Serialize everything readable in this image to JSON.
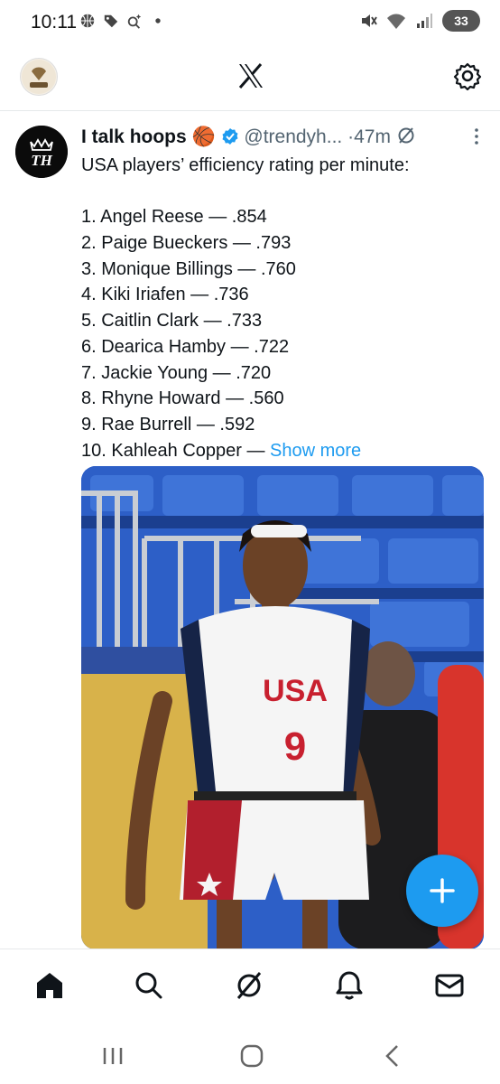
{
  "status_bar": {
    "time": "10:11",
    "battery": "33",
    "icons": [
      "basketball-icon",
      "tag-icon",
      "sparkle-search-icon",
      "dot-icon",
      "mute-icon",
      "wifi-icon",
      "signal-icon"
    ]
  },
  "top_bar": {
    "logo_icon": "x-logo-icon",
    "settings_icon": "gear-icon"
  },
  "tweet": {
    "author_name": "I talk hoops",
    "author_emoji": "🏀",
    "handle": "@trendyh...",
    "separator": "·",
    "time": "47m",
    "avatar_monogram": "TH",
    "intro": "USA players’ efficiency rating per minute:",
    "list": [
      "1. Angel Reese — .854",
      "2. Paige Bueckers — .793",
      "3. Monique Billings — .760",
      "4. Kiki Iriafen — .736",
      "5. Caitlin Clark — .733",
      "6. Dearica Hamby — .722",
      "7. Jackie Young — .720",
      "8. Rhyne Howard — .560",
      "9. Rae Burrell — .592"
    ],
    "last_item": "10. Kahleah Copper — ",
    "show_more": "Show more",
    "media": {
      "jersey_text": "USA",
      "jersey_number": "9"
    }
  },
  "fab": {
    "icon": "plus-icon"
  },
  "bottom_nav": {
    "items": [
      "home-icon",
      "search-icon",
      "grok-icon",
      "notifications-icon",
      "messages-icon"
    ]
  },
  "colors": {
    "accent": "#1d9bf0",
    "text": "#0f1419",
    "muted": "#536471"
  }
}
